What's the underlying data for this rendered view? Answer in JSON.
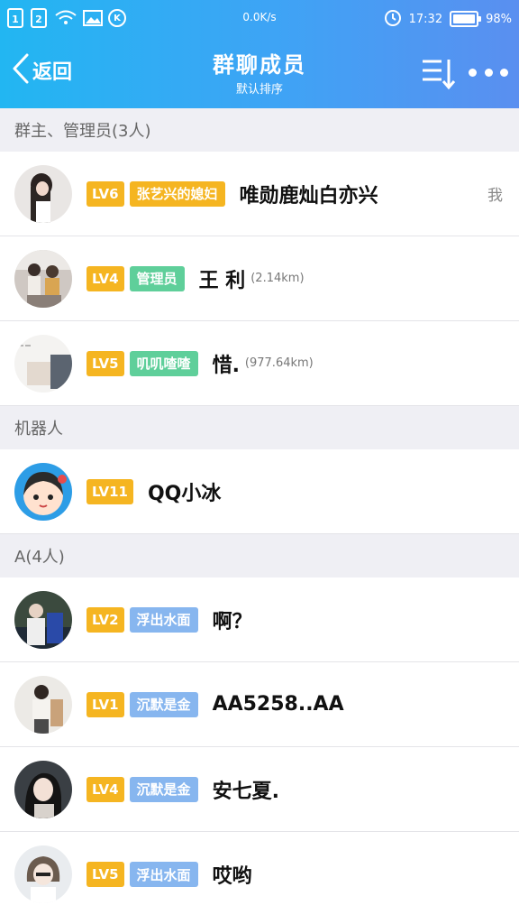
{
  "status_bar": {
    "sim1": "1",
    "sim2": "2",
    "k_label": "K",
    "speed": "0.0K/s",
    "time": "17:32",
    "battery": "98%",
    "battery_level": 0.98,
    "icons": [
      "wifi-icon",
      "image-icon",
      "alarm-icon",
      "battery-icon"
    ]
  },
  "nav": {
    "back_label": "返回",
    "title": "群聊成员",
    "subtitle": "默认排序",
    "icons": [
      "back-chevron-icon",
      "sort-icon",
      "more-icon"
    ]
  },
  "colors": {
    "header_gradient": [
      "#22b6f2",
      "#5a8ff0"
    ],
    "level_badge": "#f5b521",
    "title_orange": "#f5b521",
    "title_green": "#5fcf9a",
    "title_blue": "#87b6ef",
    "section_bg": "#efeff4"
  },
  "sections": [
    {
      "header": "群主、管理员(3人)",
      "members": [
        {
          "level": "LV6",
          "title": "张艺兴的媳妇",
          "title_color": "#f5b521",
          "name": "唯勋鹿灿白亦兴",
          "distance": "",
          "tag": "我"
        },
        {
          "level": "LV4",
          "title": "管理员",
          "title_color": "#5fcf9a",
          "name": "王 利",
          "distance": "(2.14km)",
          "tag": ""
        },
        {
          "level": "LV5",
          "title": "叽叽喳喳",
          "title_color": "#5fcf9a",
          "name": "惜.",
          "distance": "(977.64km)",
          "tag": ""
        }
      ]
    },
    {
      "header": "机器人",
      "members": [
        {
          "level": "LV11",
          "title": "",
          "title_color": "",
          "name": "QQ小冰",
          "distance": "",
          "tag": ""
        }
      ]
    },
    {
      "header": "A(4人)",
      "members": [
        {
          "level": "LV2",
          "title": "浮出水面",
          "title_color": "#87b6ef",
          "name": "啊？",
          "distance": "",
          "tag": ""
        },
        {
          "level": "LV1",
          "title": "沉默是金",
          "title_color": "#87b6ef",
          "name": "AA5258..AA",
          "distance": "",
          "tag": ""
        },
        {
          "level": "LV4",
          "title": "沉默是金",
          "title_color": "#87b6ef",
          "name": "安七夏.",
          "distance": "",
          "tag": ""
        },
        {
          "level": "LV5",
          "title": "浮出水面",
          "title_color": "#87b6ef",
          "name": "哎哟",
          "distance": "",
          "tag": ""
        }
      ]
    }
  ]
}
